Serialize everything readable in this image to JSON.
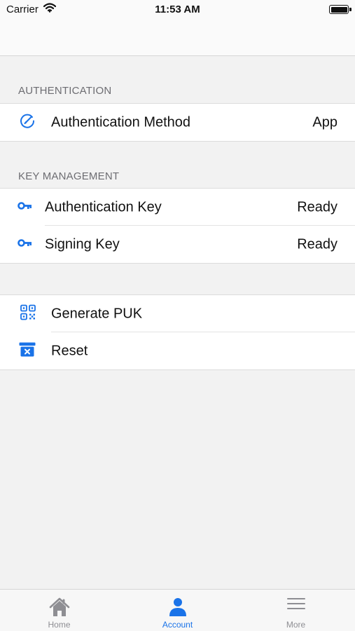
{
  "status_bar": {
    "carrier": "Carrier",
    "time": "11:53 AM"
  },
  "sections": {
    "authentication": {
      "header": "AUTHENTICATION",
      "rows": [
        {
          "label": "Authentication Method",
          "value": "App",
          "icon": "authentication-method-icon"
        }
      ]
    },
    "key_management": {
      "header": "KEY MANAGEMENT",
      "rows": [
        {
          "label": "Authentication Key",
          "value": "Ready",
          "icon": "key-icon"
        },
        {
          "label": "Signing Key",
          "value": "Ready",
          "icon": "key-icon"
        }
      ]
    },
    "actions": {
      "rows": [
        {
          "label": "Generate PUK",
          "icon": "qr-code-icon"
        },
        {
          "label": "Reset",
          "icon": "reset-box-icon"
        }
      ]
    }
  },
  "tab_bar": {
    "tabs": [
      {
        "label": "Home",
        "icon": "home-icon",
        "selected": false
      },
      {
        "label": "Account",
        "icon": "person-icon",
        "selected": true
      },
      {
        "label": "More",
        "icon": "menu-lines-icon",
        "selected": false
      }
    ]
  },
  "colors": {
    "accent": "#1a73e8",
    "tab_inactive": "#8e8e93",
    "section_header": "#6d6d72",
    "background": "#f2f2f2"
  }
}
